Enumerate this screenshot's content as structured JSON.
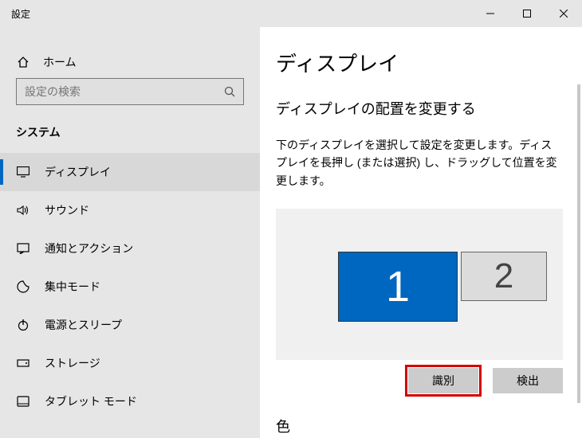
{
  "window": {
    "title": "設定"
  },
  "sidebar": {
    "home": "ホーム",
    "search_placeholder": "設定の検索",
    "section": "システム",
    "items": [
      {
        "label": "ディスプレイ"
      },
      {
        "label": "サウンド"
      },
      {
        "label": "通知とアクション"
      },
      {
        "label": "集中モード"
      },
      {
        "label": "電源とスリープ"
      },
      {
        "label": "ストレージ"
      },
      {
        "label": "タブレット モード"
      }
    ]
  },
  "main": {
    "title": "ディスプレイ",
    "subtitle": "ディスプレイの配置を変更する",
    "description": "下のディスプレイを選択して設定を変更します。ディスプレイを長押し (または選択) し、ドラッグして位置を変更します。",
    "monitors": {
      "primary": "1",
      "secondary": "2"
    },
    "buttons": {
      "identify": "識別",
      "detect": "検出"
    },
    "color_heading": "色"
  }
}
